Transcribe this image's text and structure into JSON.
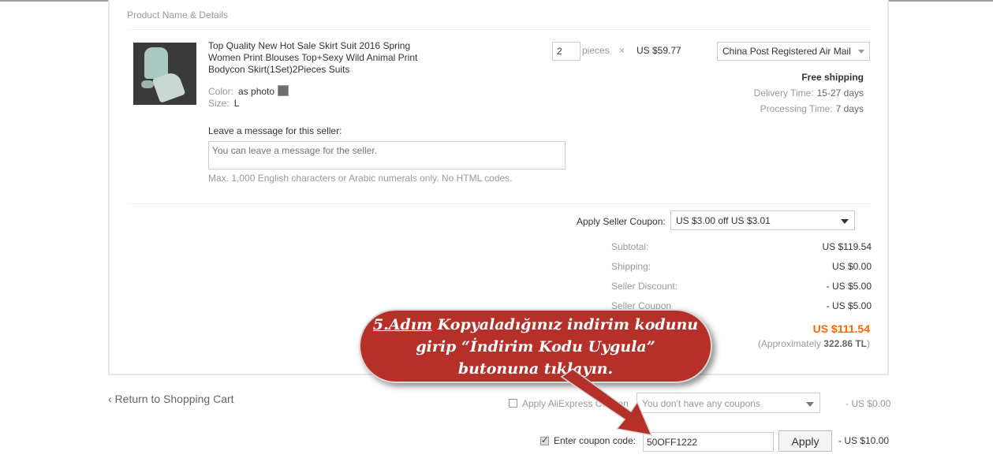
{
  "section": {
    "title": "Product Name & Details"
  },
  "product": {
    "title": "Top Quality New Hot Sale Skirt Suit 2016 Spring Women Print Blouses Top+Sexy Wild Animal Print Bodycon Skirt(1Set)2Pieces Suits",
    "color_label": "Color:",
    "color_value": "as photo",
    "size_label": "Size:",
    "size_value": "L",
    "quantity": "2",
    "quantity_unit": "pieces",
    "multiply": "×",
    "unit_price": "US $59.77"
  },
  "shipping": {
    "method": "China Post Registered Air Mail",
    "free": "Free shipping",
    "delivery_label": "Delivery Time:",
    "delivery_value": "15-27 days",
    "processing_label": "Processing Time:",
    "processing_value": "7 days"
  },
  "message": {
    "label": "Leave a message for this seller:",
    "placeholder": "You can leave a message for the seller.",
    "note": "Max. 1,000 English characters or Arabic numerals only. No HTML codes."
  },
  "seller_coupon": {
    "label": "Apply Seller Coupon:",
    "selected": "US $3.00 off US $3.01"
  },
  "summary": {
    "subtotal_label": "Subtotal:",
    "subtotal": "US $119.54",
    "shipping_label": "Shipping:",
    "shipping": "US $0.00",
    "discount_label": "Seller Discount:",
    "discount": "- US $5.00",
    "coupon_label": "Seller Coupon",
    "coupon": "- US $5.00",
    "total": "US $111.54",
    "approx_prefix": "(Approximately ",
    "approx_value": "322.86 TL",
    "approx_suffix": ")"
  },
  "footer": {
    "return_link": "‹ Return to Shopping Cart",
    "aliexpress_coupon_label": "Apply AliExpress Coupon",
    "aliexpress_coupon_selected": "You don't have any coupons",
    "aliexpress_coupon_amount": "- US $0.00",
    "coupon_code_label": "Enter coupon code:",
    "coupon_code_value": "50OFF1222",
    "apply_button": "Apply",
    "coupon_code_amount": "- US $10.00"
  },
  "callout": {
    "step": "5.Adım",
    "line1_rest": " Kopyaladığınız indirim kodunu",
    "line2": "girip “İndirim Kodu Uygula”",
    "line3": "butonuna tıklayın.",
    "color": "#b6302a"
  }
}
